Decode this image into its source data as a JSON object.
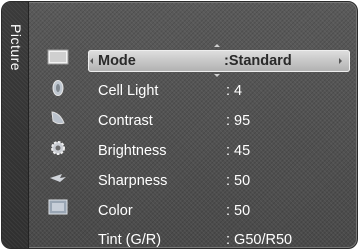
{
  "side_tab": {
    "label": "Picture"
  },
  "category_icons": [
    {
      "name": "picture-icon",
      "selected": true
    },
    {
      "name": "sound-icon",
      "selected": false
    },
    {
      "name": "channel-icon",
      "selected": false
    },
    {
      "name": "setup-icon",
      "selected": false
    },
    {
      "name": "input-icon",
      "selected": false
    },
    {
      "name": "application-icon",
      "selected": false
    }
  ],
  "menu": {
    "items": [
      {
        "label": "Mode",
        "value": ":Standard",
        "selected": true
      },
      {
        "label": "Cell Light",
        "value": ": 4",
        "selected": false
      },
      {
        "label": "Contrast",
        "value": ": 95",
        "selected": false
      },
      {
        "label": "Brightness",
        "value": ": 45",
        "selected": false
      },
      {
        "label": "Sharpness",
        "value": ": 50",
        "selected": false
      },
      {
        "label": "Color",
        "value": ": 50",
        "selected": false
      },
      {
        "label": "Tint (G/R)",
        "value": ": G50/R50",
        "selected": false
      }
    ]
  },
  "colors": {
    "panel": "#4f4f4f",
    "highlight": "#c8c8c8",
    "text": "#ffffff"
  }
}
